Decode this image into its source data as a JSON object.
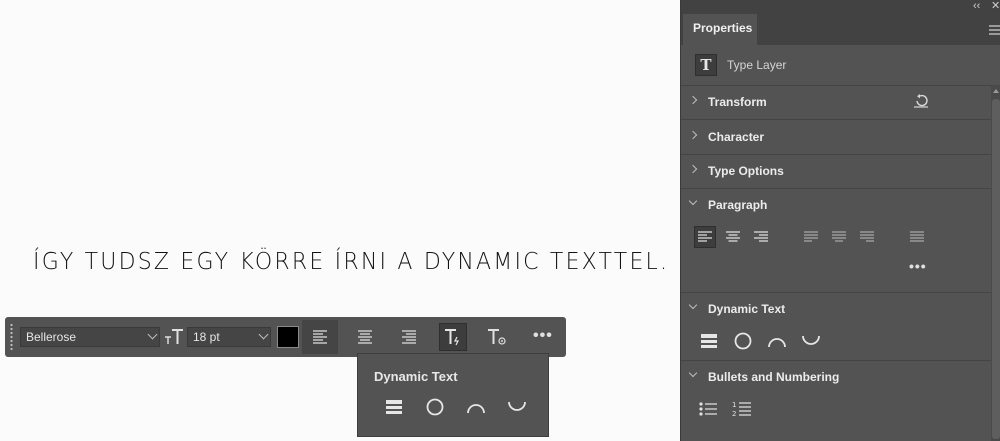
{
  "canvas": {
    "text": "ÍGY TUDSZ EGY KÖRRE ÍRNI A DYNAMIC TEXTTEL."
  },
  "taskbar": {
    "font_family": "Bellerose",
    "font_size": "18 pt",
    "color": "#000000",
    "more_label": "•••"
  },
  "popover": {
    "title": "Dynamic Text",
    "icons": [
      "stacked-lines-icon",
      "circle-icon",
      "arc-up-icon",
      "arc-down-icon"
    ]
  },
  "panel": {
    "collapse_label": "‹‹",
    "close_label": "✕",
    "tab": "Properties",
    "layer_icon": "T",
    "layer_type": "Type Layer",
    "sections": {
      "transform": "Transform",
      "character": "Character",
      "type_options": "Type Options",
      "paragraph": "Paragraph",
      "dynamic_text": "Dynamic Text",
      "bullets": "Bullets and Numbering"
    },
    "paragraph_more": "•••"
  },
  "colors": {
    "panel_bg": "#535353",
    "panel_dark": "#424242",
    "canvas_bg": "#fbfbfb",
    "icon": "#e0e0e0"
  }
}
